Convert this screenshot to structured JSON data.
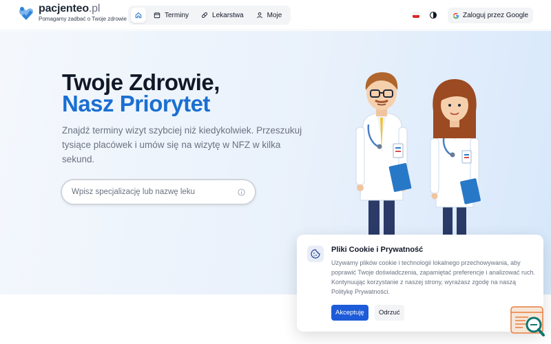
{
  "brand": {
    "name": "pacjenteo",
    "tld": ".pl",
    "tagline": "Pomagamy zadbać o Twoje zdrowie"
  },
  "nav": {
    "items": [
      {
        "label": "Terminy",
        "icon": "calendar-icon"
      },
      {
        "label": "Lekarstwa",
        "icon": "pill-icon"
      },
      {
        "label": "Moje",
        "icon": "user-icon"
      }
    ]
  },
  "header": {
    "google_login": "Zaloguj przez Google"
  },
  "hero": {
    "title_line1": "Twoje Zdrowie,",
    "title_line2": "Nasz Priorytet",
    "description": "Znajdź terminy wizyt szybciej niż kiedykolwiek. Przeszukuj tysiące placówek i umów się na wizytę w NFZ w kilka sekund.",
    "search_placeholder": "Wpisz specjalizację lub nazwę leku"
  },
  "cookie": {
    "title": "Pliki Cookie i Prywatność",
    "text": "Używamy plików cookie i technologii lokalnego przechowywania, aby poprawić Twoje doświadczenia, zapamiętać preferencje i analizować ruch. Kontynuując korzystanie z naszej strony, wyrażasz zgodę na naszą Politykę Prywatności.",
    "accept_label": "Akceptuję",
    "reject_label": "Odrzuć"
  },
  "colors": {
    "accent": "#1a6fd1",
    "button_primary": "#1d5bd8",
    "hero_bg": "#e9f1fb"
  }
}
